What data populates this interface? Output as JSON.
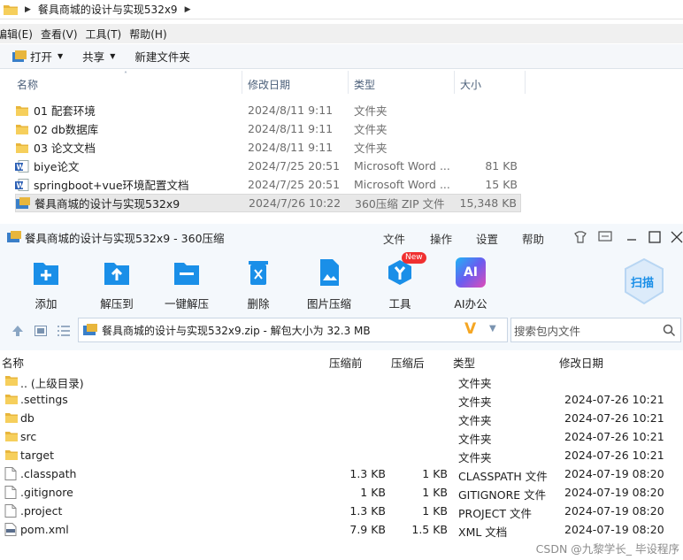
{
  "explorer": {
    "breadcrumb": "餐具商城的设计与实现532x9",
    "menu": [
      "编辑(E)",
      "查看(V)",
      "工具(T)",
      "帮助(H)"
    ],
    "toolbar": {
      "open": "打开",
      "share": "共享",
      "new_folder": "新建文件夹"
    },
    "columns": {
      "name": "名称",
      "modified": "修改日期",
      "type": "类型",
      "size": "大小"
    },
    "files": [
      {
        "name": "01 配套环境",
        "date": "2024/8/11 9:11",
        "type": "文件夹",
        "size": "",
        "icon": "folder-icon"
      },
      {
        "name": "02 db数据库",
        "date": "2024/8/11 9:11",
        "type": "文件夹",
        "size": "",
        "icon": "folder-icon"
      },
      {
        "name": "03 论文文档",
        "date": "2024/8/11 9:11",
        "type": "文件夹",
        "size": "",
        "icon": "folder-icon"
      },
      {
        "name": "biye论文",
        "date": "2024/7/25 20:51",
        "type": "Microsoft Word ...",
        "size": "81 KB",
        "icon": "word-doc-icon"
      },
      {
        "name": "springboot+vue环境配置文档",
        "date": "2024/7/25 20:51",
        "type": "Microsoft Word ...",
        "size": "15 KB",
        "icon": "word-doc-icon"
      },
      {
        "name": "餐具商城的设计与实现532x9",
        "date": "2024/7/26 10:22",
        "type": "360压缩 ZIP 文件",
        "size": "15,348 KB",
        "icon": "zip-archive-icon"
      }
    ]
  },
  "zip360": {
    "title": "餐具商城的设计与实现532x9 - 360压缩",
    "menu": [
      "文件",
      "操作",
      "设置",
      "帮助"
    ],
    "ribbon": [
      "添加",
      "解压到",
      "一键解压",
      "删除",
      "图片压缩",
      "工具",
      "AI办公"
    ],
    "new_badge": "New",
    "scan_label": "扫描",
    "ai_label": "AI",
    "path": "餐具商城的设计与实现532x9.zip - 解包大小为 32.3 MB",
    "search_placeholder": "搜索包内文件",
    "columns": {
      "name": "名称",
      "compressed": "压缩前",
      "after": "压缩后",
      "type": "类型",
      "modified": "修改日期"
    },
    "files": [
      {
        "name": ".. (上级目录)",
        "before": "",
        "after": "",
        "type": "文件夹",
        "date": "",
        "icon": "folder-icon"
      },
      {
        "name": ".settings",
        "before": "",
        "after": "",
        "type": "文件夹",
        "date": "2024-07-26 10:21",
        "icon": "folder-icon"
      },
      {
        "name": "db",
        "before": "",
        "after": "",
        "type": "文件夹",
        "date": "2024-07-26 10:21",
        "icon": "folder-icon"
      },
      {
        "name": "src",
        "before": "",
        "after": "",
        "type": "文件夹",
        "date": "2024-07-26 10:21",
        "icon": "folder-icon"
      },
      {
        "name": "target",
        "before": "",
        "after": "",
        "type": "文件夹",
        "date": "2024-07-26 10:21",
        "icon": "folder-icon"
      },
      {
        "name": ".classpath",
        "before": "1.3 KB",
        "after": "1 KB",
        "type": "CLASSPATH 文件",
        "date": "2024-07-19 08:20",
        "icon": "file-icon"
      },
      {
        "name": ".gitignore",
        "before": "1 KB",
        "after": "1 KB",
        "type": "GITIGNORE 文件",
        "date": "2024-07-19 08:20",
        "icon": "file-icon"
      },
      {
        "name": ".project",
        "before": "1.3 KB",
        "after": "1 KB",
        "type": "PROJECT 文件",
        "date": "2024-07-19 08:20",
        "icon": "file-icon"
      },
      {
        "name": "pom.xml",
        "before": "7.9 KB",
        "after": "1.5 KB",
        "type": "XML 文档",
        "date": "2024-07-19 08:20",
        "icon": "xml-file-icon"
      }
    ]
  },
  "watermark": "CSDN @九黎学长_ 毕设程序"
}
